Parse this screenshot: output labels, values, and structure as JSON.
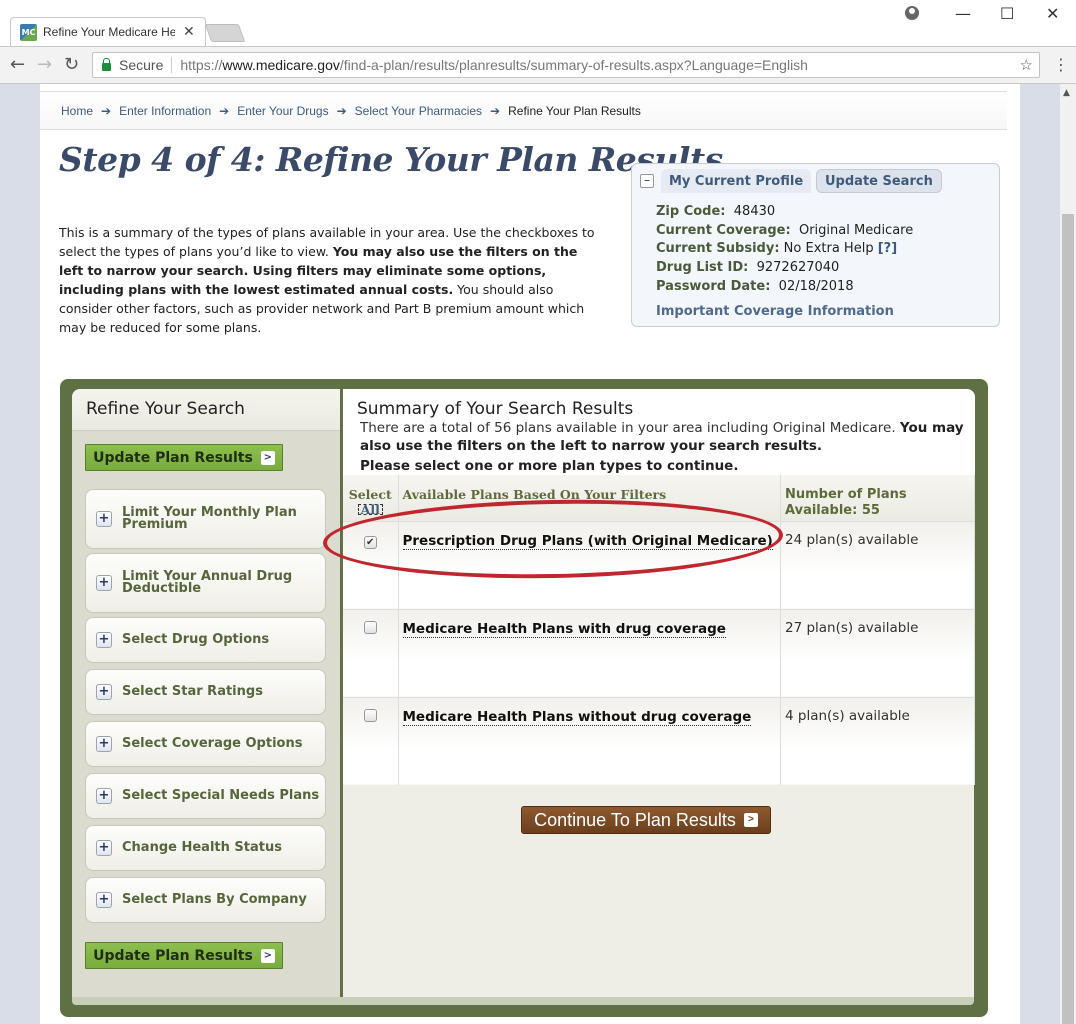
{
  "browser": {
    "tab_title": "Refine Your Medicare He",
    "favicon_text": "MC",
    "secure_label": "Secure",
    "url_scheme": "https://",
    "url_domain": "www.medicare.gov",
    "url_path": "/find-a-plan/results/planresults/summary-of-results.aspx?Language=English",
    "icons": {
      "back": "←",
      "forward": "→",
      "reload": "↻",
      "star": "☆",
      "menu": "⋮",
      "close_tab": "✕",
      "minimize": "—",
      "maximize": "☐",
      "close_window": "✕"
    }
  },
  "breadcrumb": {
    "items": [
      "Home",
      "Enter Information",
      "Enter Your Drugs",
      "Select Your Pharmacies",
      "Refine Your Plan Results"
    ],
    "separator": "➔"
  },
  "page": {
    "title": "Step 4 of 4: Refine Your Plan Results",
    "intro_plain_1": "This is a summary of the types of plans available in your area. Use the checkboxes to select the types of plans you’d like to view. ",
    "intro_bold": "You may also use the filters on the left to narrow your search. Using filters may eliminate some options, including plans with the lowest estimated annual costs.",
    "intro_plain_2": " You should also consider other factors, such as provider network and Part B premium amount which may be reduced for some plans."
  },
  "profile": {
    "collapse_symbol": "–",
    "tab_active": "My Current Profile",
    "tab_other": "Update Search",
    "rows": [
      {
        "label": "Zip Code:",
        "value": "48430"
      },
      {
        "label": "Current Coverage:",
        "value": "Original Medicare"
      },
      {
        "label": "Current Subsidy:",
        "value": "No Extra Help",
        "help": "[?]"
      },
      {
        "label": "Drug List ID:",
        "value": "9272627040"
      },
      {
        "label": "Password Date:",
        "value": "02/18/2018"
      }
    ],
    "important_link": "Important Coverage Information"
  },
  "sidebar": {
    "title": "Refine Your Search",
    "update_button": "Update Plan Results",
    "filters": [
      "Limit Your Monthly Plan Premium",
      "Limit Your Annual Drug Deductible",
      "Select Drug Options",
      "Select Star Ratings",
      "Select Coverage Options",
      "Select Special Needs Plans",
      "Change Health Status",
      "Select Plans By Company"
    ]
  },
  "results": {
    "title": "Summary of Your Search Results",
    "desc_plain": "There are a total of 56 plans available in your area including Original Medicare. ",
    "desc_bold": "You may also use the filters on the left to narrow your search results.",
    "prompt": "Please select one or more plan types to continue.",
    "columns": {
      "select": "Select",
      "select_all": "All",
      "plans": "Available Plans Based On Your Filters",
      "number": "Number of Plans Available:  55"
    },
    "rows": [
      {
        "name": "Prescription Drug Plans (with Original Medicare)",
        "count": "24 plan(s) available",
        "checked": true
      },
      {
        "name": "Medicare Health Plans with drug coverage",
        "count": "27 plan(s) available",
        "checked": false
      },
      {
        "name": "Medicare Health Plans without drug coverage",
        "count": "4 plan(s) available",
        "checked": false
      }
    ],
    "continue_button": "Continue To Plan Results"
  },
  "colors": {
    "frame_green": "#5f7044",
    "update_button_green": "#8cbf4d",
    "continue_brown": "#7a4a24",
    "annotation_red": "#c0262e",
    "title_blue": "#3a4a68"
  }
}
